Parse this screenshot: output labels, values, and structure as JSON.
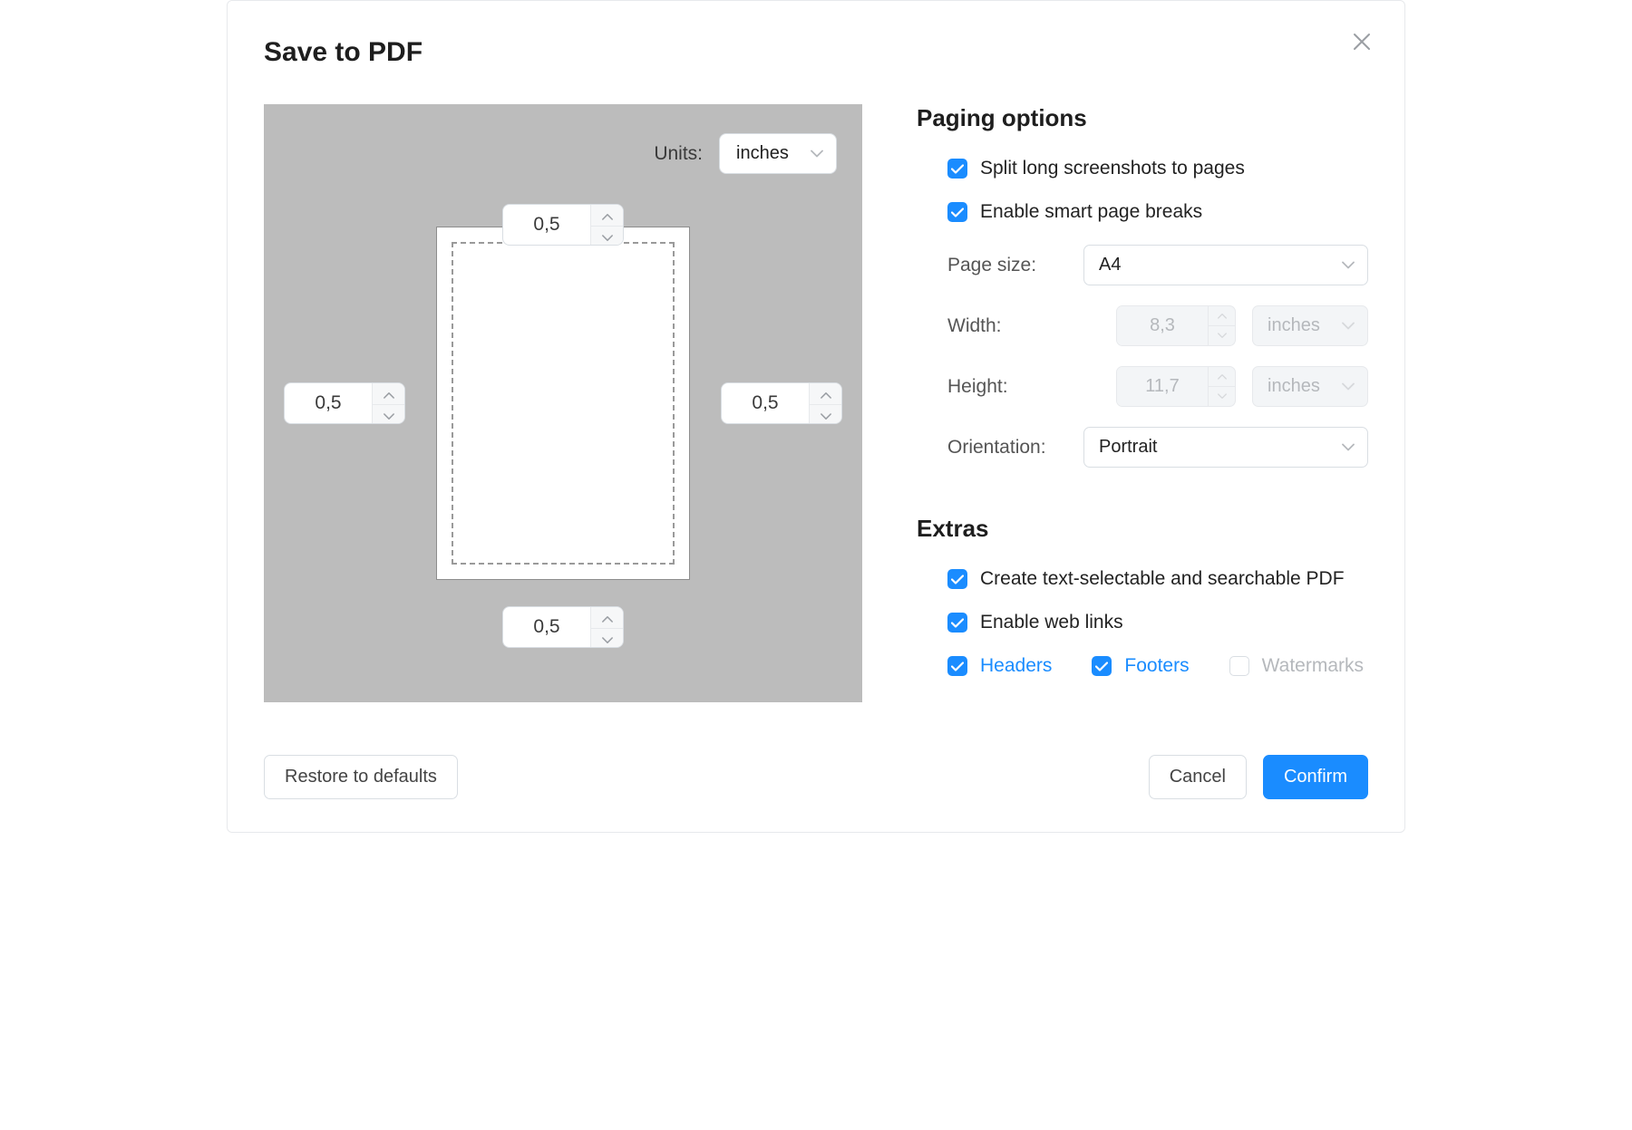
{
  "dialog": {
    "title": "Save to PDF"
  },
  "preview": {
    "units_label": "Units:",
    "units_value": "inches",
    "margins": {
      "top": "0,5",
      "bottom": "0,5",
      "left": "0,5",
      "right": "0,5"
    }
  },
  "paging": {
    "title": "Paging options",
    "split_label": "Split long screenshots to pages",
    "split_checked": true,
    "smart_label": "Enable smart page breaks",
    "smart_checked": true,
    "page_size_label": "Page size:",
    "page_size_value": "A4",
    "width_label": "Width:",
    "width_value": "8,3",
    "width_unit": "inches",
    "height_label": "Height:",
    "height_value": "11,7",
    "height_unit": "inches",
    "orientation_label": "Orientation:",
    "orientation_value": "Portrait"
  },
  "extras": {
    "title": "Extras",
    "searchable_label": "Create text-selectable and searchable PDF",
    "searchable_checked": true,
    "weblinks_label": "Enable web links",
    "weblinks_checked": true,
    "headers_label": "Headers",
    "headers_checked": true,
    "footers_label": "Footers",
    "footers_checked": true,
    "watermarks_label": "Watermarks",
    "watermarks_checked": false
  },
  "buttons": {
    "restore": "Restore to defaults",
    "cancel": "Cancel",
    "confirm": "Confirm"
  }
}
